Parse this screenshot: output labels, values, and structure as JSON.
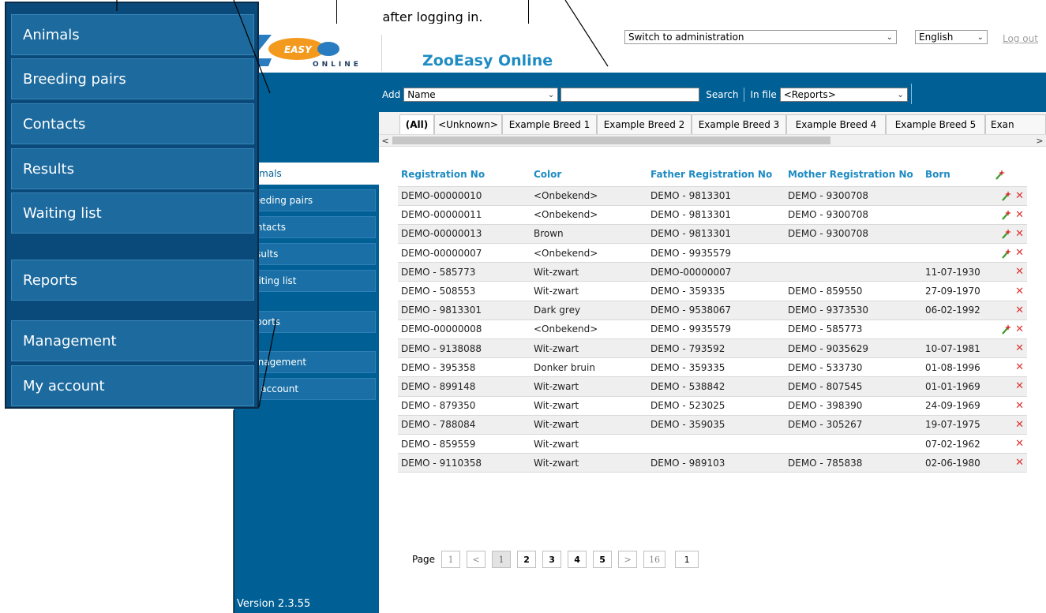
{
  "callout": {
    "text": "after logging in."
  },
  "zoom_menu": {
    "items": [
      "Animals",
      "Breeding pairs",
      "Contacts",
      "Results",
      "Waiting list",
      "Reports",
      "Management",
      "My account"
    ]
  },
  "header": {
    "title": "ZooEasy Online",
    "logo": {
      "word_top": "EASY",
      "word_bottom": "ONLINE",
      "brand_colors": [
        "#2a7cc0",
        "#f39a1e"
      ]
    },
    "admin_select": "Switch to administration",
    "language_select": "English",
    "logout": "Log out"
  },
  "toolbar": {
    "add_label": "Add",
    "add_field": "Name",
    "search_value": "",
    "search_label": "Search",
    "infile_label": "In file",
    "infile_select": "<Reports>"
  },
  "sidebar": {
    "items": [
      "Animals",
      "Breeding pairs",
      "Contacts",
      "Results",
      "Waiting list",
      "Reports",
      "Management",
      "My account"
    ],
    "active": "Animals",
    "version": "Version 2.3.55"
  },
  "tabs": [
    "(All)",
    "<Unknown>",
    "Example Breed 1",
    "Example Breed 2",
    "Example Breed 3",
    "Example Breed 4",
    "Example Breed 5",
    "Exan"
  ],
  "table": {
    "columns": [
      "Registration No",
      "Color",
      "Father Registration No",
      "Mother Registration No",
      "Born"
    ],
    "rows": [
      {
        "reg": "DEMO-00000010",
        "color": "<Onbekend>",
        "father": "DEMO - 9813301",
        "mother": "DEMO - 9300708",
        "born": "",
        "wand": true
      },
      {
        "reg": "DEMO-00000011",
        "color": "<Onbekend>",
        "father": "DEMO - 9813301",
        "mother": "DEMO - 9300708",
        "born": "",
        "wand": true
      },
      {
        "reg": "DEMO-00000013",
        "color": "Brown",
        "father": "DEMO - 9813301",
        "mother": "DEMO - 9300708",
        "born": "",
        "wand": true
      },
      {
        "reg": "DEMO-00000007",
        "color": "<Onbekend>",
        "father": "DEMO - 9935579",
        "mother": "",
        "born": "",
        "wand": true
      },
      {
        "reg": "DEMO - 585773",
        "color": "Wit-zwart",
        "father": "DEMO-00000007",
        "mother": "",
        "born": "11-07-1930",
        "wand": false
      },
      {
        "reg": "DEMO - 508553",
        "color": "Wit-zwart",
        "father": "DEMO - 359335",
        "mother": "DEMO - 859550",
        "born": "27-09-1970",
        "wand": false
      },
      {
        "reg": "DEMO - 9813301",
        "color": "Dark grey",
        "father": "DEMO - 9538067",
        "mother": "DEMO - 9373530",
        "born": "06-02-1992",
        "wand": false
      },
      {
        "reg": "DEMO-00000008",
        "color": "<Onbekend>",
        "father": "DEMO - 9935579",
        "mother": "DEMO - 585773",
        "born": "",
        "wand": true
      },
      {
        "reg": "DEMO - 9138088",
        "color": "Wit-zwart",
        "father": "DEMO - 793592",
        "mother": "DEMO - 9035629",
        "born": "10-07-1981",
        "wand": false
      },
      {
        "reg": "DEMO - 395358",
        "color": "Donker bruin",
        "father": "DEMO - 359335",
        "mother": "DEMO - 533730",
        "born": "01-08-1996",
        "wand": false
      },
      {
        "reg": "DEMO - 899148",
        "color": "Wit-zwart",
        "father": "DEMO - 538842",
        "mother": "DEMO - 807545",
        "born": "01-01-1969",
        "wand": false
      },
      {
        "reg": "DEMO - 879350",
        "color": "Wit-zwart",
        "father": "DEMO - 523025",
        "mother": "DEMO - 398390",
        "born": "24-09-1969",
        "wand": false
      },
      {
        "reg": "DEMO - 788084",
        "color": "Wit-zwart",
        "father": "DEMO - 359035",
        "mother": "DEMO - 305267",
        "born": "19-07-1975",
        "wand": false
      },
      {
        "reg": "DEMO - 859559",
        "color": "Wit-zwart",
        "father": "",
        "mother": "",
        "born": "07-02-1962",
        "wand": false
      },
      {
        "reg": "DEMO - 9110358",
        "color": "Wit-zwart",
        "father": "DEMO - 989103",
        "mother": "DEMO - 785838",
        "born": "02-06-1980",
        "wand": false
      }
    ]
  },
  "pager": {
    "label": "Page",
    "first": "1",
    "prev": "<",
    "pages": [
      "1",
      "2",
      "3",
      "4",
      "5"
    ],
    "current": "1",
    "next": ">",
    "last": "16",
    "goto": "1"
  },
  "colors": {
    "primary_blue": "#005f95",
    "accent_blue": "#1e8bc3",
    "delete_red": "#e03030",
    "wand_green": "#3a9a2a"
  }
}
